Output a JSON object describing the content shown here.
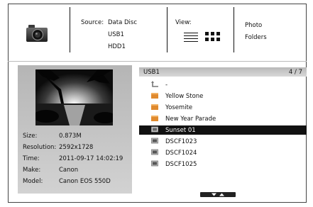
{
  "header": {
    "camera_icon": "camera-icon",
    "source_label": "Source:",
    "sources": [
      "Data Disc",
      "USB1",
      "HDD1"
    ],
    "view_label": "View:",
    "view_modes": [
      "list-view-icon",
      "grid-view-icon"
    ],
    "content_modes": [
      "Photo",
      "Folders"
    ]
  },
  "info": {
    "rows": [
      {
        "key": "Size:",
        "value": "0.873M"
      },
      {
        "key": "Resolution:",
        "value": "2592x1728"
      },
      {
        "key": "Time:",
        "value": "2011-09-17 14:02:19"
      },
      {
        "key": "Make:",
        "value": "Canon"
      },
      {
        "key": "Model:",
        "value": "Canon EOS 550D"
      }
    ]
  },
  "list": {
    "path": "USB1",
    "count": "4 / 7",
    "up_label": "-",
    "items": [
      {
        "label": "Yellow Stone",
        "type": "folder"
      },
      {
        "label": "Yosemite",
        "type": "folder"
      },
      {
        "label": "New Year Parade",
        "type": "folder"
      },
      {
        "label": "Sunset 01",
        "type": "photo",
        "selected": true
      },
      {
        "label": "DSCF1023",
        "type": "photo"
      },
      {
        "label": "DSCF1024",
        "type": "photo"
      },
      {
        "label": "DSCF1025",
        "type": "photo"
      }
    ]
  },
  "colors": {
    "folder": "#e08a2e",
    "selection": "#111111"
  }
}
